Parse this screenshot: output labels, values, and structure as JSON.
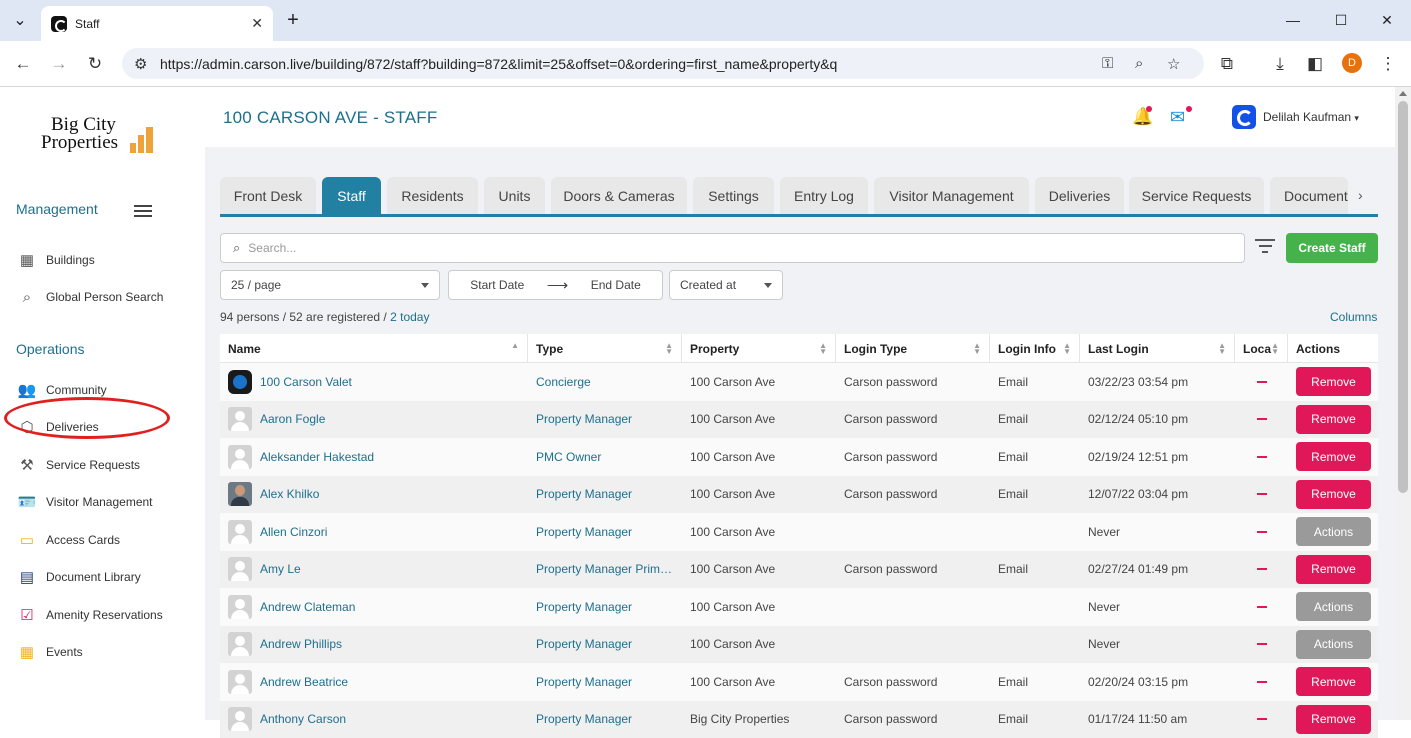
{
  "browser": {
    "tab_title": "Staff",
    "url": "https://admin.carson.live/building/872/staff?building=872&limit=25&offset=0&ordering=first_name&property&q",
    "profile_initial": "D"
  },
  "sidebar": {
    "logo_line1": "Big City",
    "logo_line2": "Properties",
    "management_title": "Management",
    "operations_title": "Operations",
    "management_items": [
      {
        "label": "Buildings",
        "icon": "building-icon"
      },
      {
        "label": "Global Person Search",
        "icon": "search-icon"
      }
    ],
    "operations_items": [
      {
        "label": "Community",
        "icon": "people-icon"
      },
      {
        "label": "Deliveries",
        "icon": "package-icon"
      },
      {
        "label": "Service Requests",
        "icon": "hammer-icon"
      },
      {
        "label": "Visitor Management",
        "icon": "id-card-icon"
      },
      {
        "label": "Access Cards",
        "icon": "credit-card-icon"
      },
      {
        "label": "Document Library",
        "icon": "document-icon"
      },
      {
        "label": "Amenity Reservations",
        "icon": "calendar-check-icon"
      },
      {
        "label": "Events",
        "icon": "calendar-icon"
      }
    ],
    "highlight_color": "#e0201f"
  },
  "header": {
    "page_title": "100 CARSON AVE - STAFF",
    "user_name": "Delilah Kaufman",
    "user_caret": "▾"
  },
  "tabs": [
    "Front Desk",
    "Staff",
    "Residents",
    "Units",
    "Doors & Cameras",
    "Settings",
    "Entry Log",
    "Visitor Management",
    "Deliveries",
    "Service Requests",
    "Document"
  ],
  "active_tab": "Staff",
  "toolbar": {
    "search_placeholder": "Search...",
    "create_label": "Create Staff",
    "page_size": "25 / page",
    "start_date": "Start Date",
    "end_date": "End Date",
    "sort_select": "Created at"
  },
  "summary": {
    "text": "94 persons / 52 are registered / ",
    "link": "2 today",
    "columns_link": "Columns"
  },
  "table": {
    "headers": [
      "Name",
      "Type",
      "Property",
      "Login Type",
      "Login Info",
      "Last Login",
      "Loca",
      "Actions"
    ],
    "rows": [
      {
        "name": "100 Carson Valet",
        "avatar": "logo",
        "type": "Concierge",
        "property": "100 Carson Ave",
        "login_type": "Carson password",
        "login_info": "Email",
        "last_login": "03/22/23 03:54 pm",
        "action": "Remove"
      },
      {
        "name": "Aaron Fogle",
        "avatar": "default",
        "type": "Property Manager",
        "property": "100 Carson Ave",
        "login_type": "Carson password",
        "login_info": "Email",
        "last_login": "02/12/24 05:10 pm",
        "action": "Remove"
      },
      {
        "name": "Aleksander Hakestad",
        "avatar": "default",
        "type": "PMC Owner",
        "property": "100 Carson Ave",
        "login_type": "Carson password",
        "login_info": "Email",
        "last_login": "02/19/24 12:51 pm",
        "action": "Remove"
      },
      {
        "name": "Alex Khilko",
        "avatar": "photo",
        "type": "Property Manager",
        "property": "100 Carson Ave",
        "login_type": "Carson password",
        "login_info": "Email",
        "last_login": "12/07/22 03:04 pm",
        "action": "Remove"
      },
      {
        "name": "Allen Cinzori",
        "avatar": "default",
        "type": "Property Manager",
        "property": "100 Carson Ave",
        "login_type": "",
        "login_info": "",
        "last_login": "Never",
        "action": "Actions"
      },
      {
        "name": "Amy Le",
        "avatar": "default",
        "type": "Property Manager Prim…",
        "property": "100 Carson Ave",
        "login_type": "Carson password",
        "login_info": "Email",
        "last_login": "02/27/24 01:49 pm",
        "action": "Remove"
      },
      {
        "name": "Andrew Clateman",
        "avatar": "default",
        "type": "Property Manager",
        "property": "100 Carson Ave",
        "login_type": "",
        "login_info": "",
        "last_login": "Never",
        "action": "Actions"
      },
      {
        "name": "Andrew Phillips",
        "avatar": "default",
        "type": "Property Manager",
        "property": "100 Carson Ave",
        "login_type": "",
        "login_info": "",
        "last_login": "Never",
        "action": "Actions"
      },
      {
        "name": "Andrew Beatrice",
        "avatar": "default",
        "type": "Property Manager",
        "property": "100 Carson Ave",
        "login_type": "Carson password",
        "login_info": "Email",
        "last_login": "02/20/24 03:15 pm",
        "action": "Remove"
      },
      {
        "name": "Anthony Carson",
        "avatar": "default",
        "type": "Property Manager",
        "property": "Big City Properties",
        "login_type": "Carson password",
        "login_info": "Email",
        "last_login": "01/17/24 11:50 am",
        "action": "Remove"
      }
    ]
  },
  "colors": {
    "accent": "#2280a3",
    "create": "#45b24b",
    "remove": "#e0185a",
    "actions": "#9a9a9a"
  }
}
